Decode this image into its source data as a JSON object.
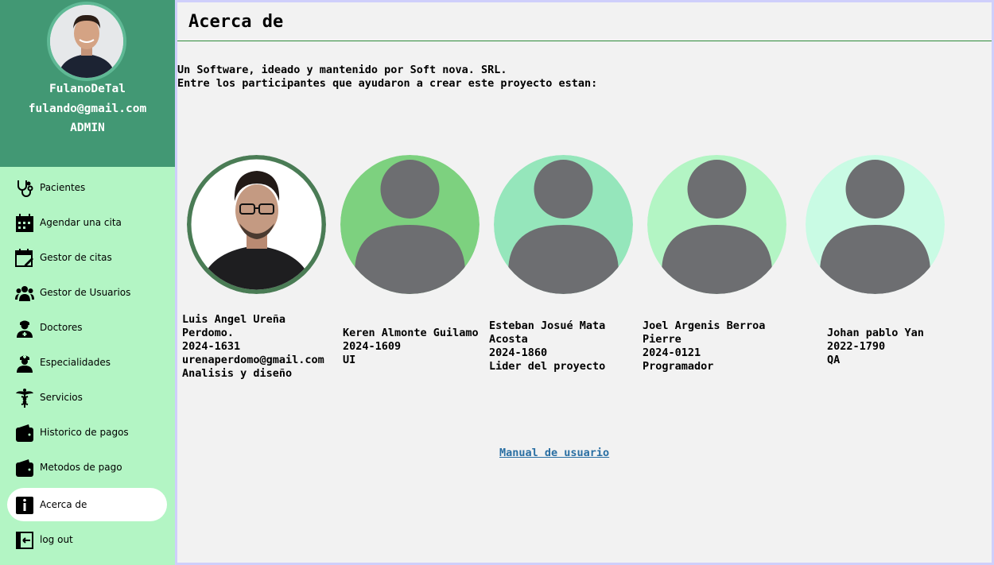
{
  "user": {
    "name": "FulanoDeTal",
    "email": "fulando@gmail.com",
    "role": "ADMIN"
  },
  "nav": {
    "pacientes": "Pacientes",
    "agendar": "Agendar una cita",
    "gestor_citas": "Gestor de citas",
    "gestor_usuarios": "Gestor de Usuarios",
    "doctores": "Doctores",
    "especialidades": "Especialidades",
    "servicios": "Servicios",
    "historico": "Historico de pagos",
    "metodos": "Metodos de pago",
    "acerca": "Acerca de",
    "logout": "log out"
  },
  "page": {
    "title": "Acerca de",
    "intro_line1": "Un Software, ideado y mantenido por Soft nova. SRL.",
    "intro_line2": "Entre los participantes que ayudaron a crear este proyecto estan:",
    "manual_link": "Manual de usuario"
  },
  "participants": [
    {
      "name_line1": "Luis Angel Ureña",
      "name_line2": "Perdomo.",
      "id": "2024-1631",
      "email": "urenaperdomo@gmail.com",
      "role": "Analisis y diseño",
      "avatar_color": "#4a7c55"
    },
    {
      "name_line1": "Keren Almonte Guilamo",
      "id": "2024-1609",
      "role": "UI",
      "avatar_color": "#7dd17f"
    },
    {
      "name_line1": "Esteban Josué Mata",
      "name_line2": "Acosta",
      "id": "2024-1860",
      "role": "Lider del proyecto",
      "avatar_color": "#95e6bb"
    },
    {
      "name_line1": "Joel Argenis Berroa",
      "name_line2": "Pierre",
      "id": "2024-0121",
      "role": "Programador",
      "avatar_color": "#b3f5c4"
    },
    {
      "name_line1": "Johan pablo Yan",
      "id": "2022-1790",
      "role": "QA",
      "avatar_color": "#c9fbe4"
    }
  ],
  "colors": {
    "sidebar_bg": "#b3f5c4",
    "profile_bg": "#429874",
    "active_item_bg": "#ffffff",
    "avatar_placeholder": "#6d6e71",
    "link": "#2a6fa3"
  }
}
